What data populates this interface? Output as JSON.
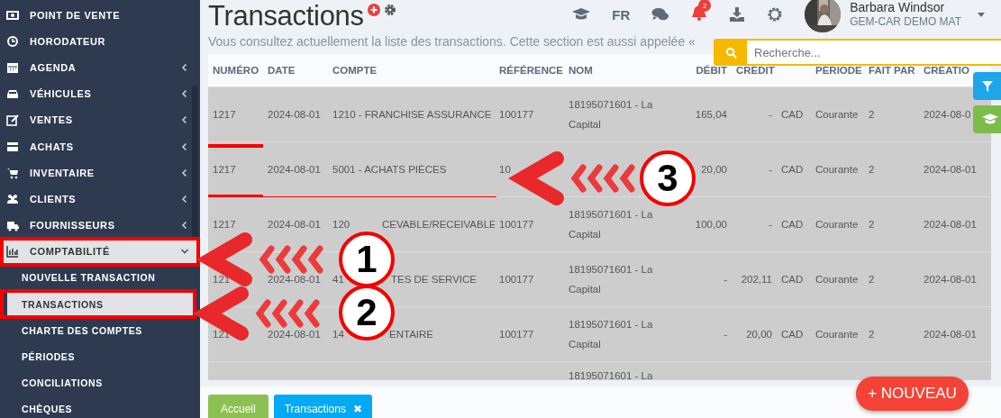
{
  "sidebar": {
    "items": [
      {
        "label": "POINT DE VENTE",
        "selected": false,
        "outlined": false
      },
      {
        "label": "HORODATEUR",
        "selected": false,
        "outlined": false
      },
      {
        "label": "AGENDA",
        "expanded": false,
        "selected": false,
        "outlined": false
      },
      {
        "label": "VÉHICULES",
        "expanded": false,
        "selected": false,
        "outlined": false
      },
      {
        "label": "VENTES",
        "expanded": false,
        "selected": false,
        "outlined": false
      },
      {
        "label": "ACHATS",
        "expanded": false,
        "selected": false,
        "outlined": false
      },
      {
        "label": "INVENTAIRE",
        "expanded": false,
        "selected": false,
        "outlined": false
      },
      {
        "label": "CLIENTS",
        "expanded": false,
        "selected": false,
        "outlined": false
      },
      {
        "label": "FOURNISSEURS",
        "expanded": false,
        "selected": false,
        "outlined": false
      },
      {
        "label": "COMPTABILITÉ",
        "expanded": true,
        "selected": true,
        "outlined": true,
        "children": [
          {
            "label": "NOUVELLE TRANSACTION",
            "selected": false,
            "outlined": false
          },
          {
            "label": "TRANSACTIONS",
            "selected": true,
            "outlined": true
          },
          {
            "label": "CHARTE DES COMPTES",
            "selected": false,
            "outlined": false
          },
          {
            "label": "PÉRIODES",
            "selected": false,
            "outlined": false
          },
          {
            "label": "CONCILIATIONS",
            "selected": false,
            "outlined": false
          },
          {
            "label": "CHÈQUES",
            "selected": false,
            "outlined": false
          }
        ]
      }
    ]
  },
  "header": {
    "title": "Transactions",
    "subtitle": "Vous consultez actuellement la liste des transactions. Cette section est aussi appelée «",
    "language": "FR",
    "notifications": "2",
    "user": {
      "name": "Barbara Windsor",
      "company": "GEM-CAR DEMO MAT"
    }
  },
  "search": {
    "placeholder": "Recherche..."
  },
  "table": {
    "columns": [
      "NUMÉRO",
      "DATE",
      "COMPTE",
      "RÉFÉRENCE",
      "NOM",
      "DÉBIT",
      "CRÉDIT",
      "PÉRIODE",
      "FAIT PAR",
      "CRÉATIO"
    ],
    "rows": [
      {
        "numero": "1217",
        "date": "2024-08-01",
        "compte": [
          "1210 - FRANCHISE ASSURANCE"
        ],
        "reference": "100177",
        "nom": "18195071601 - La Capital",
        "debit": "165,04",
        "credit": "-",
        "devise": "CAD",
        "periode": "Courante",
        "fait_par": "2",
        "creation": "2024-08-0",
        "outlined": false
      },
      {
        "numero": "1217",
        "date": "2024-08-01",
        "compte": [
          "5001 - ACHATS PIÈCES"
        ],
        "reference": "10",
        "debit": "20,00",
        "credit": "-",
        "devise": "CAD",
        "periode": "Courante",
        "fait_par": "2",
        "creation": "2024-08-01",
        "outlined": true
      },
      {
        "numero": "1217",
        "date": "2024-08-01",
        "compte": [
          "120",
          "CEVABLE/RECEIVABLE"
        ],
        "reference": "100177",
        "nom": "18195071601 - La Capital",
        "debit": "100,00",
        "credit": "-",
        "devise": "CAD",
        "periode": "Courante",
        "fait_par": "2",
        "creation": "2024-08-01",
        "outlined": false
      },
      {
        "numero": "121",
        "date": "2024-08-01",
        "compte": [
          "41",
          "TES DE SERVICE"
        ],
        "reference": "100177",
        "nom": "18195071601 - La Capital",
        "debit": "-",
        "credit": "202,11",
        "devise": "CAD",
        "periode": "Courante",
        "fait_par": "2",
        "creation": "2024-08-01",
        "outlined": false
      },
      {
        "numero": "121",
        "date": "2024-08-01",
        "compte": [
          "14",
          "ENTAIRE"
        ],
        "reference": "100177",
        "nom": "18195071601 - La Capital",
        "debit": "-",
        "credit": "20,00",
        "devise": "CAD",
        "periode": "Courante",
        "fait_par": "2",
        "creation": "2024-08-01",
        "outlined": false
      },
      {
        "nom": "18195071601 - La",
        "outlined": false
      }
    ]
  },
  "new_button": {
    "label": "+ NOUVEAU"
  },
  "tabs": [
    {
      "label": "Accueil",
      "selected": false,
      "closable": false
    },
    {
      "label": "Transactions",
      "selected": true,
      "closable": true,
      "close_glyph": "✖"
    }
  ],
  "callouts": [
    {
      "number": "1"
    },
    {
      "number": "2"
    },
    {
      "number": "3"
    }
  ]
}
